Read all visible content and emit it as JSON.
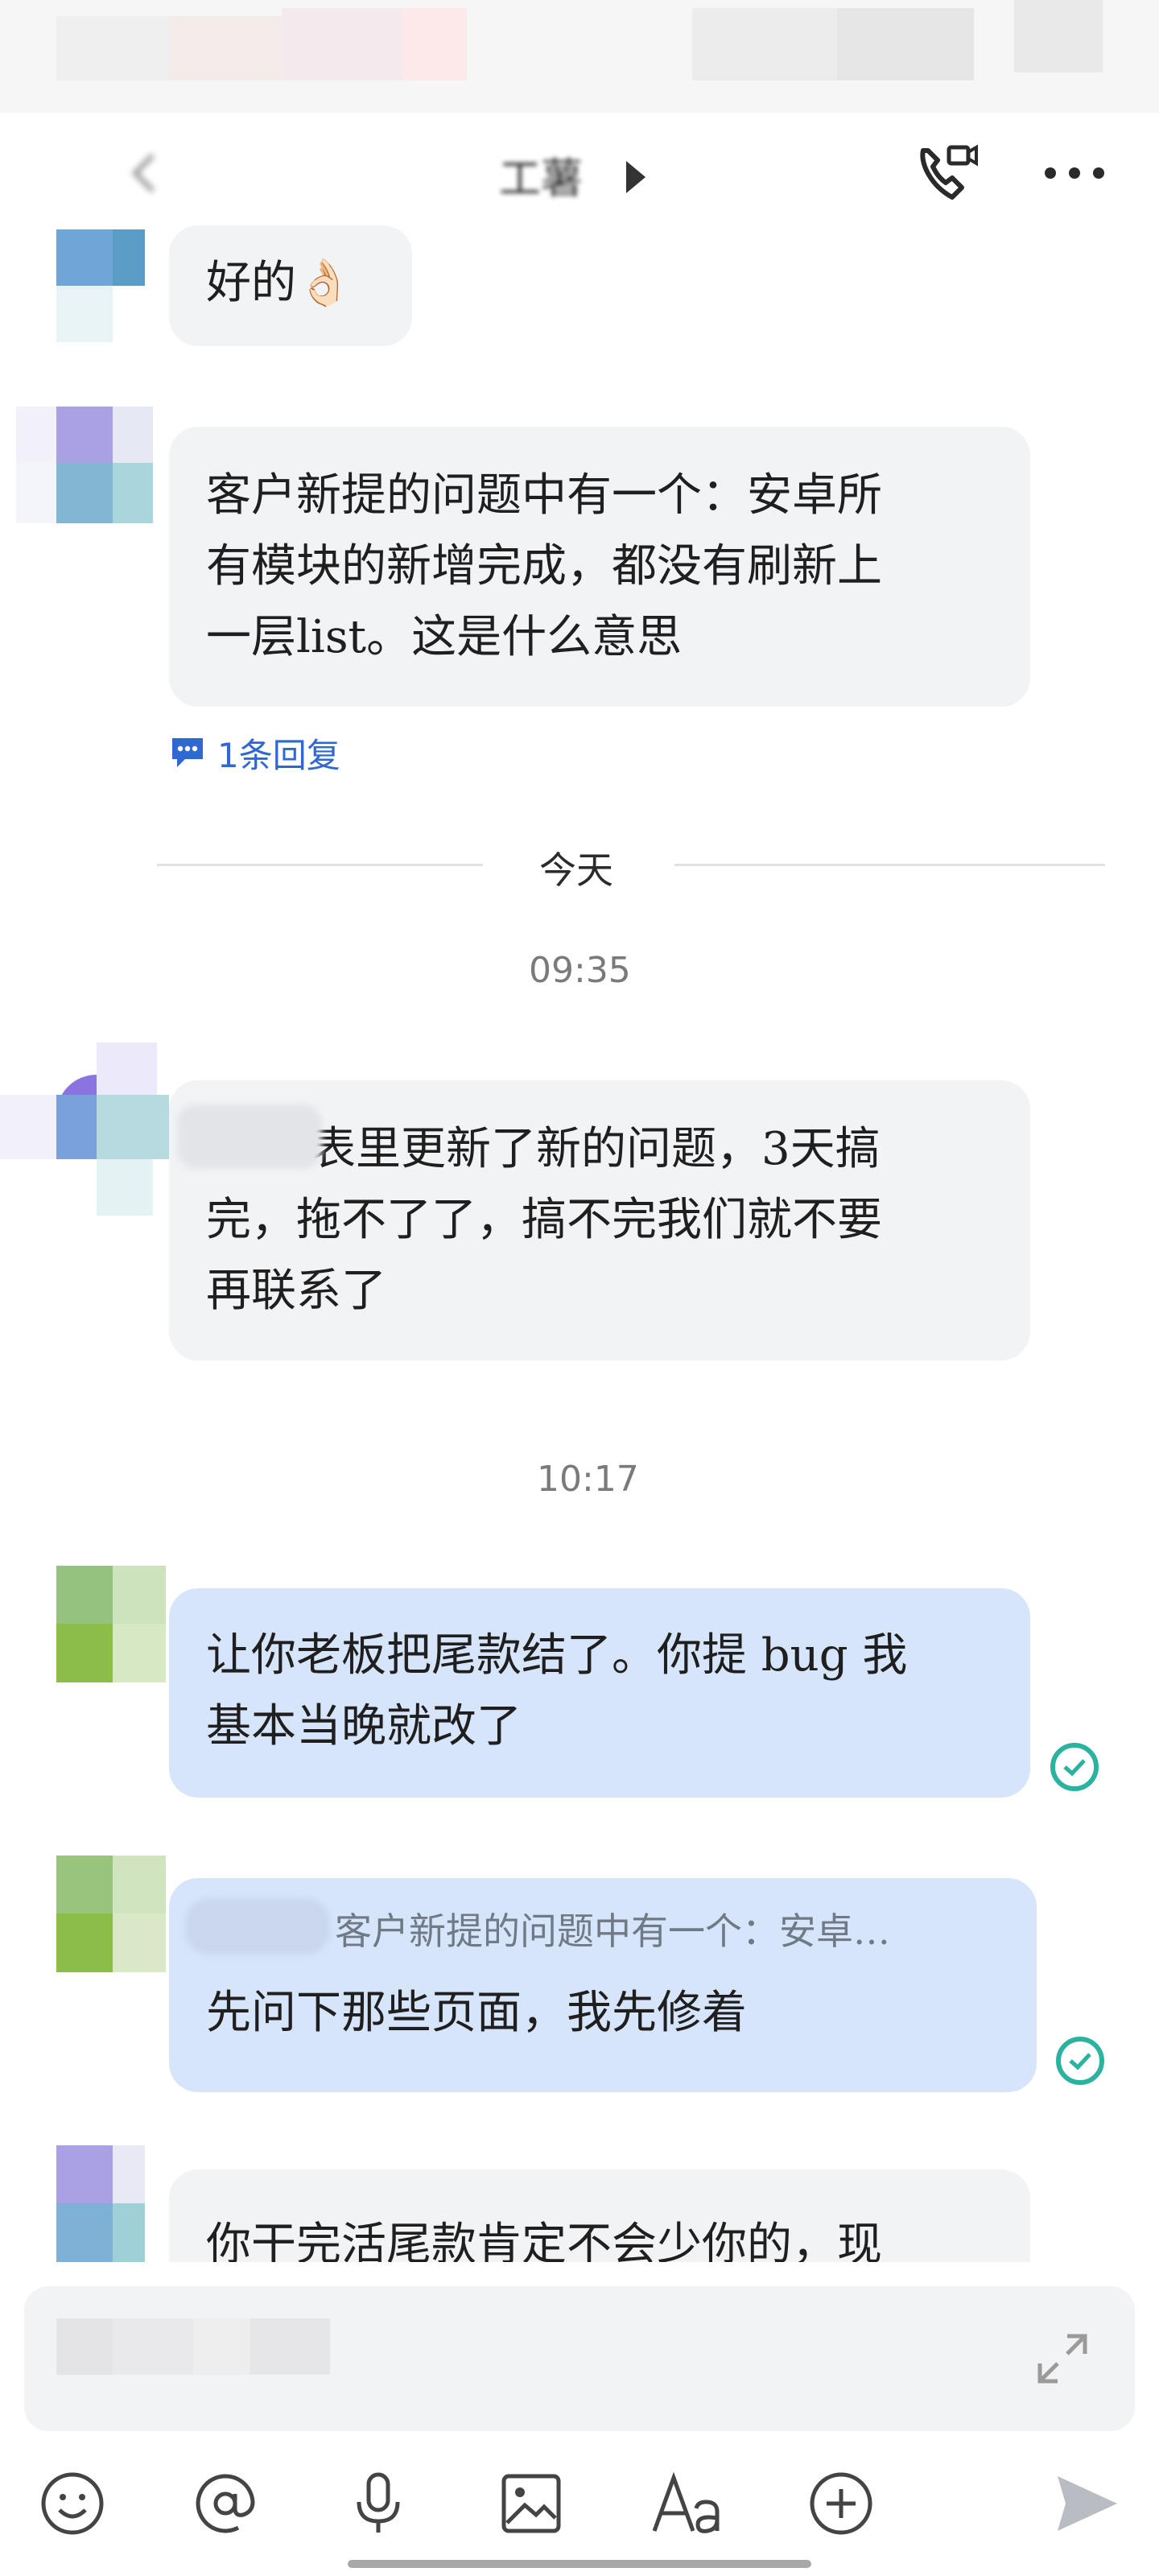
{
  "header": {
    "title": "工薯",
    "call_icon": "video-call-icon",
    "more_icon": "more-dots-icon"
  },
  "messages": [
    {
      "text": "好的👌🏻"
    },
    {
      "text": "客户新提的问题中有一个：安卓所\n有模块的新增完成，都没有刷新上\n一层list。这是什么意思",
      "reply_count": "1条回复"
    },
    {
      "text": "表里更新了新的问题，3天搞\n完，拖不了了，搞不完我们就不要\n再联系了"
    },
    {
      "text": "让你老板把尾款结了。你提 bug 我\n基本当晚就改了"
    },
    {
      "quote": "客户新提的问题中有一个：安卓…",
      "text": "先问下那些页面，我先修着"
    },
    {
      "text": "你干完活尾款肯定不会少你的，现"
    }
  ],
  "separators": {
    "day": "今天",
    "time1": "09:35",
    "time2": "10:17"
  },
  "toolbar": {
    "icons": [
      "emoji-icon",
      "mention-icon",
      "microphone-icon",
      "image-icon",
      "text-format-icon",
      "add-icon",
      "send-icon"
    ]
  },
  "colors": {
    "incoming_bubble": "#f2f3f5",
    "outgoing_bubble": "#d7e5fb",
    "read_check": "#2bb39f",
    "link": "#2f68d3"
  }
}
